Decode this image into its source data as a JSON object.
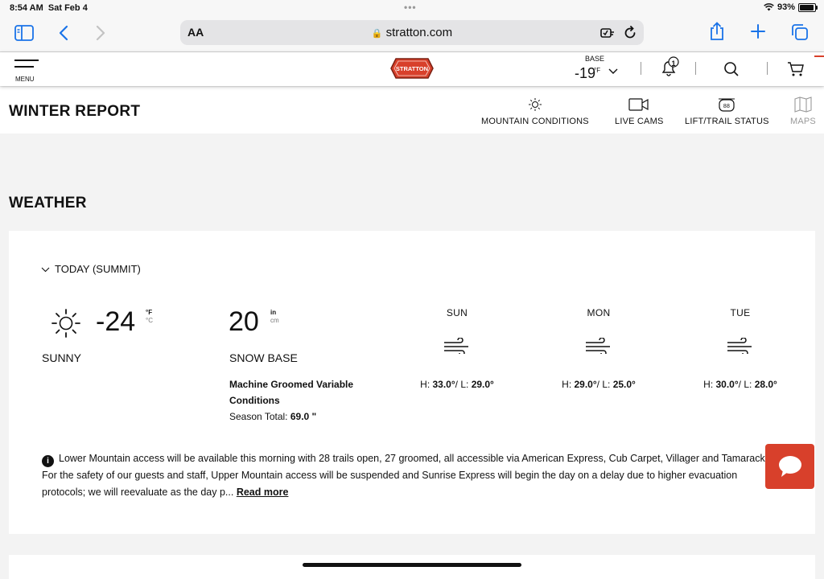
{
  "status_bar": {
    "time": "8:54 AM",
    "date": "Sat Feb 4",
    "battery": "93%",
    "battery_level": 0.93
  },
  "browser": {
    "text_size_label": "AA",
    "url": "stratton.com"
  },
  "header": {
    "menu_label": "MENU",
    "logo_text": "STRATTON",
    "base_label": "BASE",
    "base_temp": "-19",
    "base_unit": "°F",
    "notification_count": "1"
  },
  "report": {
    "title": "WINTER REPORT",
    "nav": [
      {
        "label": "MOUNTAIN CONDITIONS",
        "icon": "sun-icon"
      },
      {
        "label": "LIVE CAMS",
        "icon": "video-icon"
      },
      {
        "label": "LIFT/TRAIL STATUS",
        "icon": "lift-icon"
      },
      {
        "label": "MAPS",
        "icon": "map-icon"
      }
    ]
  },
  "weather": {
    "title": "WEATHER",
    "toggle_label": "TODAY (SUMMIT)",
    "temperature": "-24",
    "unit_f": "°F",
    "unit_c": "°C",
    "condition": "SUNNY",
    "snow_base": "20",
    "unit_in": "in",
    "unit_cm": "cm",
    "snow_base_label": "SNOW BASE",
    "surface": "Machine Groomed Variable Conditions",
    "season_total_label": "Season Total:",
    "season_total_value": "69.0 \"",
    "forecast": [
      {
        "day": "SUN",
        "h_label": "H:",
        "high": "33.0°",
        "l_label": "/ L:",
        "low": "29.0°",
        "icon": "wind-icon"
      },
      {
        "day": "MON",
        "h_label": "H:",
        "high": "29.0°",
        "l_label": "/ L:",
        "low": "25.0°",
        "icon": "wind-icon"
      },
      {
        "day": "TUE",
        "h_label": "H:",
        "high": "30.0°",
        "l_label": "/ L:",
        "low": "28.0°",
        "icon": "wind-icon"
      }
    ],
    "notice": "Lower Mountain access will be available this morning with 28 trails open, 27 groomed, all accessible via American Express, Cub Carpet, Villager and Tamarack. For the safety of our guests and staff, Upper Mountain access will be suspended and Sunrise Express will begin the day on a delay due to higher evacuation protocols; we will reevaluate as the day p...",
    "read_more": "Read more"
  },
  "colors": {
    "accent": "#1a73e8",
    "brand": "#d8402b"
  }
}
